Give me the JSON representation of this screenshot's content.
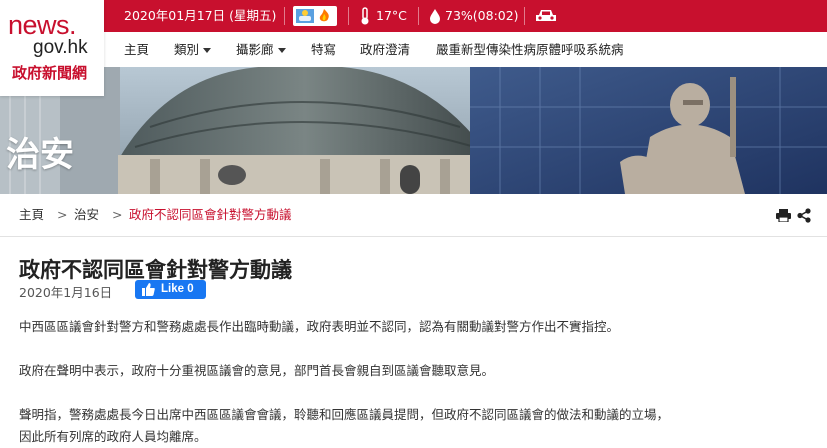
{
  "header": {
    "date": "2020年01月17日 (星期五)",
    "temperature": "17°C",
    "humidity": "73%(08:02)",
    "icons": [
      "weather-cloud-icon",
      "fire-warning-icon",
      "thermometer-icon",
      "water-drop-icon",
      "car-icon"
    ],
    "accent_color": "#c8102e"
  },
  "logo": {
    "news": "news.",
    "gov": "gov.hk",
    "cn": "政府新聞網"
  },
  "nav": {
    "items": [
      {
        "label": "主頁"
      },
      {
        "label": "類別"
      },
      {
        "label": "攝影廊"
      },
      {
        "label": "特寫"
      },
      {
        "label": "政府澄清"
      },
      {
        "label": "嚴重新型傳染性病原體呼吸系統病"
      }
    ]
  },
  "banner": {
    "title": "治安"
  },
  "breadcrumb": {
    "items": [
      "主頁",
      "治安",
      "政府不認同區會針對警方動議"
    ],
    "separator": ">"
  },
  "article": {
    "title": "政府不認同區會針對警方動議",
    "date": "2020年1月16日",
    "like_label": "Like 0",
    "paragraphs": [
      "中西區區議會針對警方和警務處處長作出臨時動議，政府表明並不認同，認為有關動議對警方作出不實指控。",
      "政府在聲明中表示，政府十分重視區議會的意見，部門首長會親自到區議會聽取意見。",
      "聲明指，警務處處長今日出席中西區區議會會議，聆聽和回應區議員提問，但政府不認同區議會的做法和動議的立場，",
      "因此所有列席的政府人員均離席。"
    ]
  }
}
